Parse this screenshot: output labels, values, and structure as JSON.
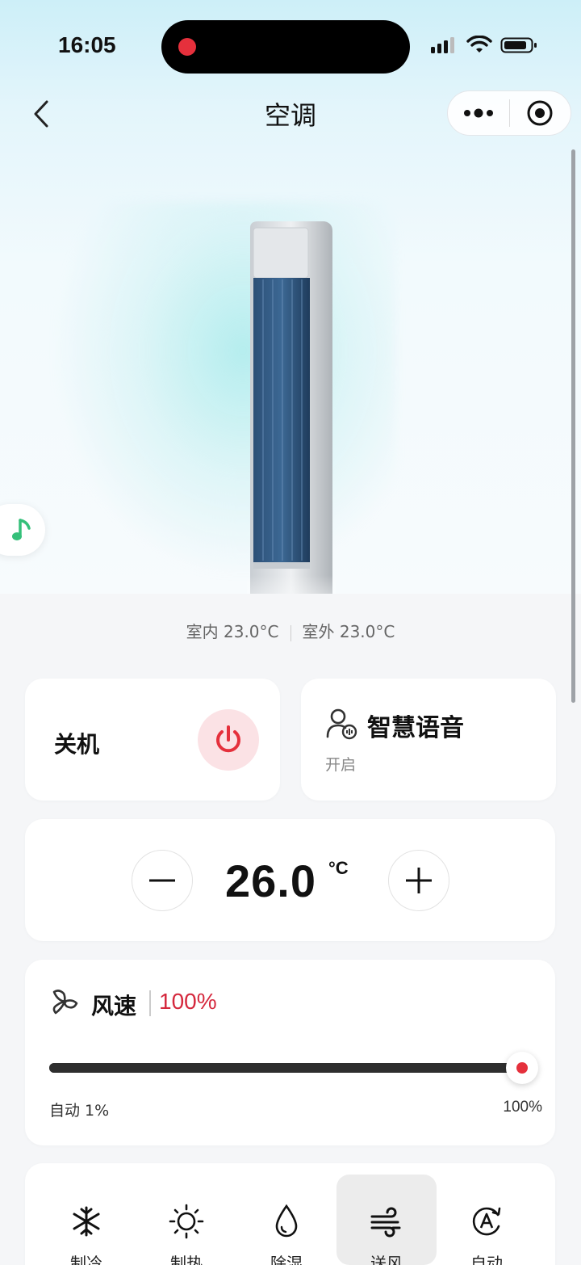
{
  "status_bar": {
    "time": "16:05"
  },
  "nav": {
    "title": "空调"
  },
  "temps": {
    "indoor": "室内 23.0°C",
    "outdoor": "室外 23.0°C"
  },
  "power": {
    "label": "关机"
  },
  "voice": {
    "title": "智慧语音",
    "status": "开启"
  },
  "temperature": {
    "value": "26.0",
    "unit": "°C"
  },
  "fan": {
    "title": "风速",
    "value": "100%",
    "level": 1.0,
    "min_label": "自动  1%",
    "max_label": "100%"
  },
  "modes": [
    {
      "label": "制冷",
      "icon": "snowflake-icon",
      "active": false
    },
    {
      "label": "制热",
      "icon": "sun-icon",
      "active": false
    },
    {
      "label": "除湿",
      "icon": "droplet-icon",
      "active": false
    },
    {
      "label": "送风",
      "icon": "wind-icon",
      "active": true
    },
    {
      "label": "自动",
      "icon": "auto-icon",
      "active": false
    }
  ],
  "colors": {
    "accent": "#e5303c",
    "power_bg": "#fbe2e5",
    "percent": "#d5283d"
  }
}
